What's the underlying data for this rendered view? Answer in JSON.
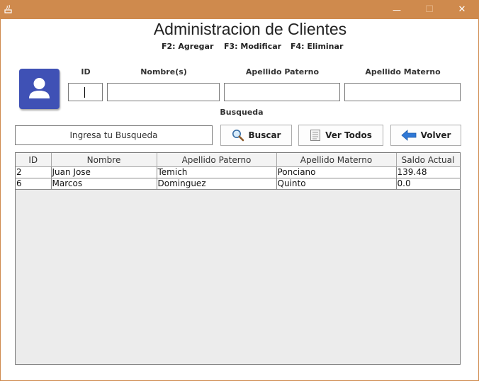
{
  "window": {
    "minimize_glyph": "—",
    "maximize_glyph": "☐",
    "close_glyph": "✕"
  },
  "header": {
    "title": "Administracion de Clientes",
    "shortcuts": [
      "F2: Agregar",
      "F3: Modificar",
      "F4: Eliminar"
    ]
  },
  "form": {
    "labels": {
      "id": "ID",
      "nombre": "Nombre(s)",
      "apellido_paterno": "Apellido Paterno",
      "apellido_materno": "Apellido Materno"
    },
    "values": {
      "id": "",
      "nombre": "",
      "apellido_paterno": "",
      "apellido_materno": ""
    }
  },
  "search": {
    "section_label": "Busqueda",
    "placeholder": "Ingresa tu Busqueda",
    "buscar_label": "Buscar",
    "ver_todos_label": "Ver Todos",
    "volver_label": "Volver"
  },
  "table": {
    "columns": [
      "ID",
      "Nombre",
      "Apellido Paterno",
      "Apellido Materno",
      "Saldo Actual"
    ],
    "rows": [
      [
        "2",
        "Juan Jose",
        "Temich",
        "Ponciano",
        "139.48"
      ],
      [
        "6",
        "Marcos",
        "Dominguez",
        "Quinto",
        "0.0"
      ]
    ]
  },
  "colors": {
    "titlebar": "#cf8a4d",
    "avatar_bg": "#3f51b5",
    "back_arrow": "#2f78d6"
  }
}
